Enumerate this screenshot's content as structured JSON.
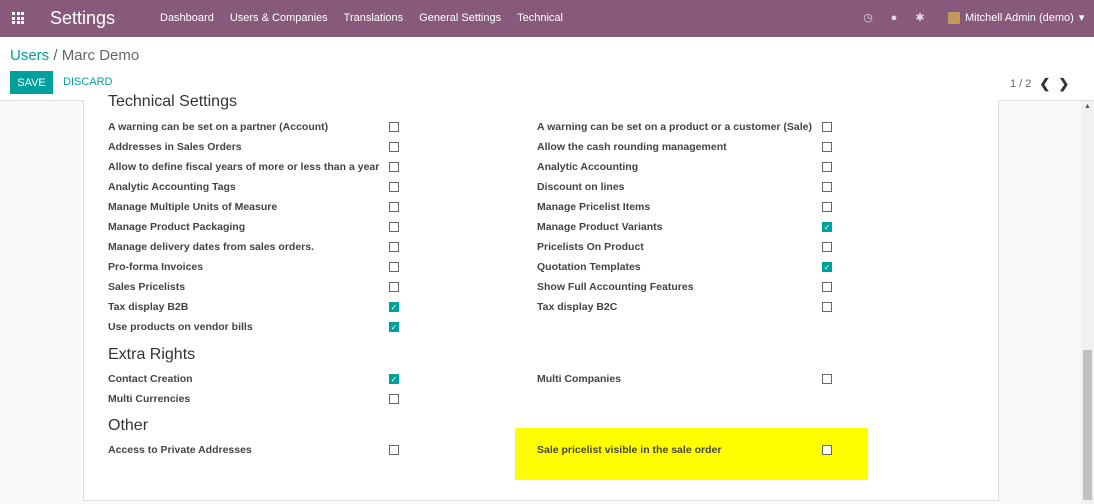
{
  "navbar": {
    "app_title": "Settings",
    "menu": [
      "Dashboard",
      "Users & Companies",
      "Translations",
      "General Settings",
      "Technical"
    ],
    "icons": [
      "clock-icon",
      "chat-icon",
      "bug-icon"
    ],
    "user": "Mitchell Admin (demo)",
    "user_caret": "▾"
  },
  "control_panel": {
    "breadcrumb_parent": "Users",
    "breadcrumb_sep": "/",
    "breadcrumb_current": "Marc Demo",
    "save_label": "SAVE",
    "discard_label": "DISCARD",
    "pager": "1 / 2",
    "pager_prev": "❮",
    "pager_next": "❯"
  },
  "sections": {
    "technical": {
      "title": "Technical Settings",
      "left": [
        {
          "label": "A warning can be set on a partner (Account)",
          "checked": false
        },
        {
          "label": "Addresses in Sales Orders",
          "checked": false
        },
        {
          "label": "Allow to define fiscal years of more or less than a year",
          "checked": false
        },
        {
          "label": "Analytic Accounting Tags",
          "checked": false
        },
        {
          "label": "Manage Multiple Units of Measure",
          "checked": false
        },
        {
          "label": "Manage Product Packaging",
          "checked": false
        },
        {
          "label": "Manage delivery dates from sales orders.",
          "checked": false
        },
        {
          "label": "Pro-forma Invoices",
          "checked": false
        },
        {
          "label": "Sales Pricelists",
          "checked": false
        },
        {
          "label": "Tax display B2B",
          "checked": true
        },
        {
          "label": "Use products on vendor bills",
          "checked": true
        }
      ],
      "right": [
        {
          "label": "A warning can be set on a product or a customer (Sale)",
          "checked": false
        },
        {
          "label": "Allow the cash rounding management",
          "checked": false
        },
        {
          "label": "Analytic Accounting",
          "checked": false
        },
        {
          "label": "Discount on lines",
          "checked": false
        },
        {
          "label": "Manage Pricelist Items",
          "checked": false
        },
        {
          "label": "Manage Product Variants",
          "checked": true
        },
        {
          "label": "Pricelists On Product",
          "checked": false
        },
        {
          "label": "Quotation Templates",
          "checked": true
        },
        {
          "label": "Show Full Accounting Features",
          "checked": false
        },
        {
          "label": "Tax display B2C",
          "checked": false
        }
      ]
    },
    "extra": {
      "title": "Extra Rights",
      "left": [
        {
          "label": "Contact Creation",
          "checked": true
        },
        {
          "label": "Multi Currencies",
          "checked": false
        }
      ],
      "right": [
        {
          "label": "Multi Companies",
          "checked": false
        }
      ]
    },
    "other": {
      "title": "Other",
      "left": [
        {
          "label": "Access to Private Addresses",
          "checked": false
        }
      ],
      "right": [
        {
          "label": "Sale pricelist visible in the sale order",
          "checked": false
        }
      ]
    }
  },
  "colors": {
    "navbar": "#875a7b",
    "accent": "#00a09d",
    "highlight": "#ffff00"
  }
}
